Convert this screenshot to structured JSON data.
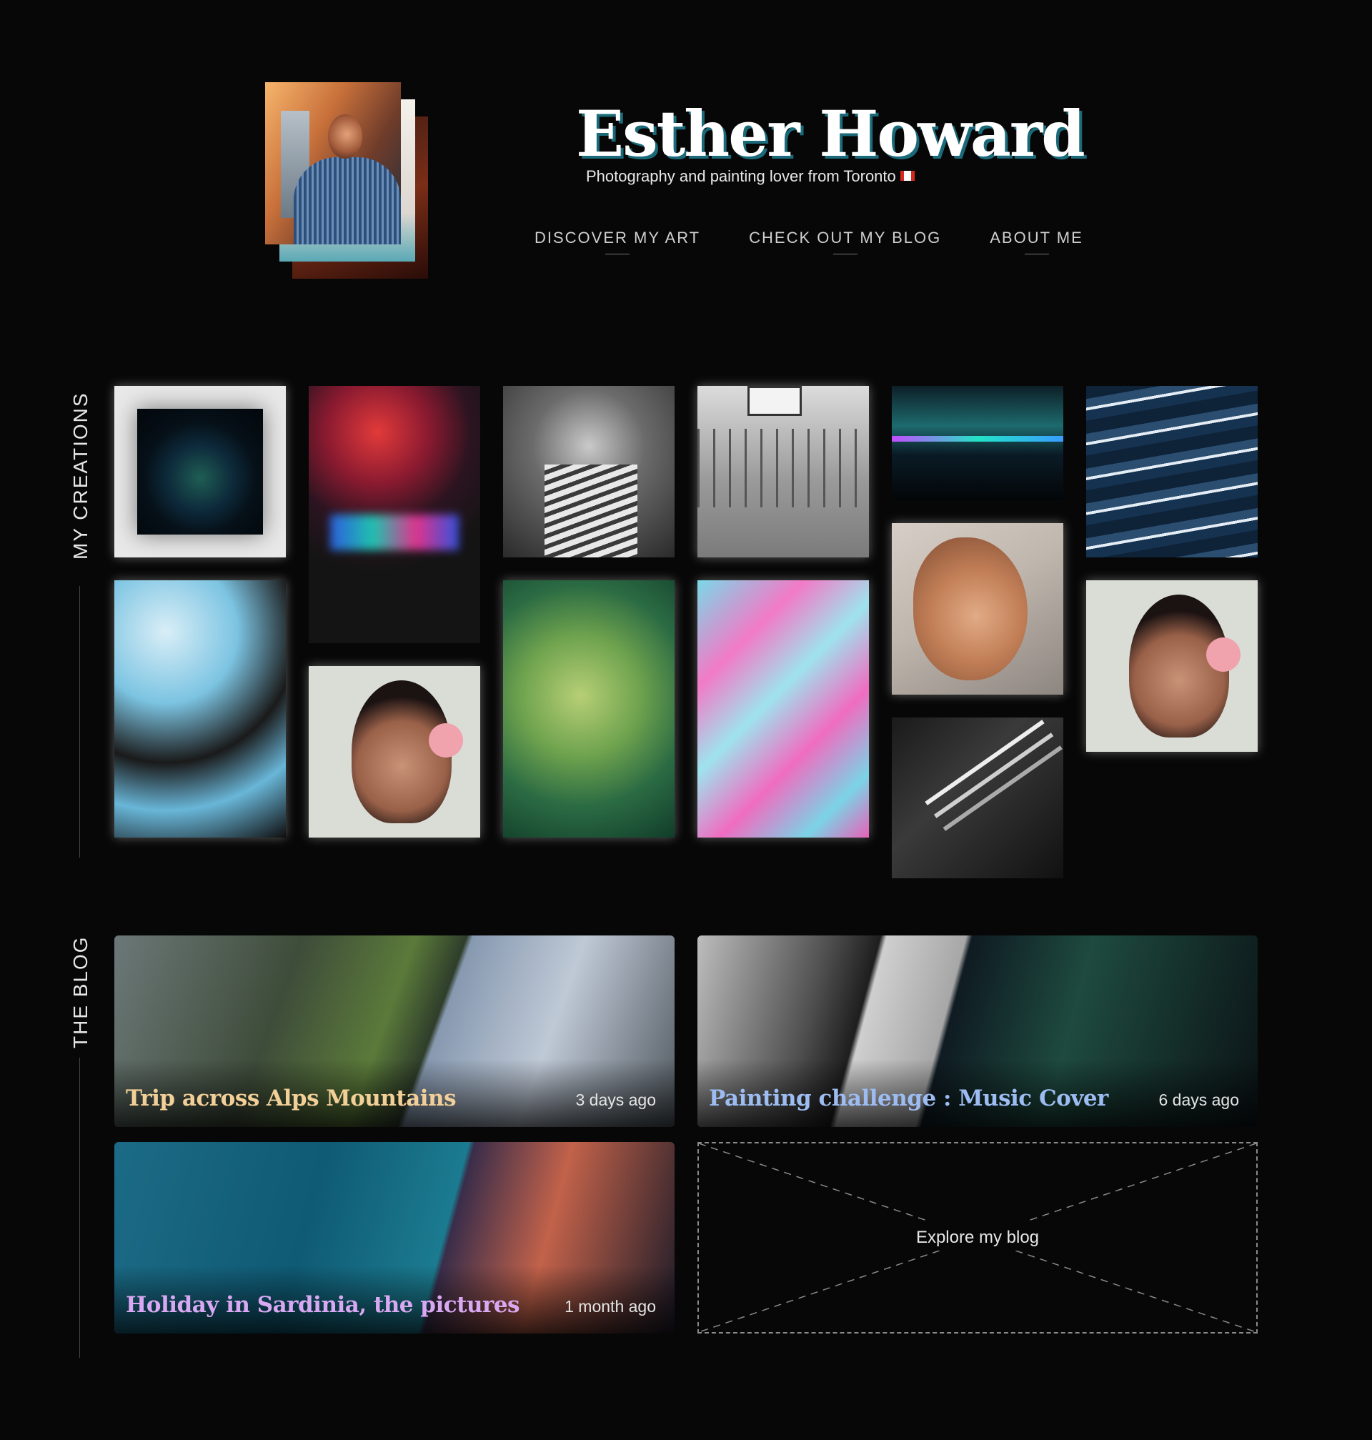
{
  "profile": {
    "name": "Esther Howard",
    "tagline": "Photography and painting lover from Toronto",
    "flag_icon": "canada-flag-icon"
  },
  "nav": {
    "items": [
      {
        "label": "DISCOVER MY ART"
      },
      {
        "label": "CHECK OUT MY BLOG"
      },
      {
        "label": "ABOUT ME"
      }
    ]
  },
  "sections": {
    "creations_label": "MY CREATIONS",
    "blog_label": "THE BLOG"
  },
  "gallery": {
    "items": [
      {
        "name": "abstract-painting-framed"
      },
      {
        "name": "neon-bokeh-street"
      },
      {
        "name": "bw-portrait-sweater"
      },
      {
        "name": "bw-basketball-player"
      },
      {
        "name": "city-night-skyline"
      },
      {
        "name": "blue-wave-painting"
      },
      {
        "name": "blue-fluid-art"
      },
      {
        "name": "portrait-drawing-rose"
      },
      {
        "name": "green-smoke-portrait"
      },
      {
        "name": "pink-blue-fluid-art"
      },
      {
        "name": "woman-face-drawing"
      },
      {
        "name": "portrait-drawing-rose-2"
      },
      {
        "name": "bw-light-beams"
      }
    ]
  },
  "blog": {
    "posts": [
      {
        "title": "Trip across Alps Mountains",
        "date": "3 days ago",
        "color": "#f3cf98"
      },
      {
        "title": "Painting challenge : Music Cover",
        "date": "6 days ago",
        "color": "#9cbcf2"
      },
      {
        "title": "Holiday in Sardinia, the pictures",
        "date": "1 month ago",
        "color": "#d9a8f2"
      }
    ],
    "explore_label": "Explore my blog"
  }
}
